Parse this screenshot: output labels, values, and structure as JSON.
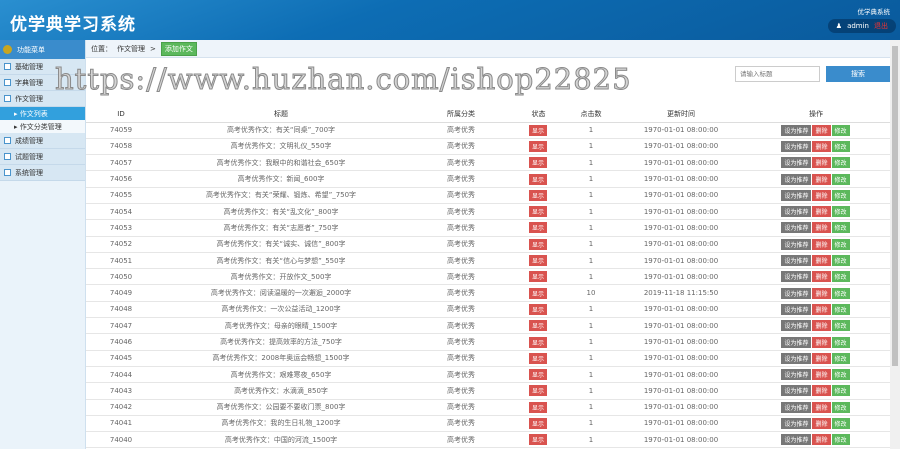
{
  "header": {
    "title": "优学典学习系统",
    "system_name": "优学典系统",
    "user": "admin",
    "logout": "退出"
  },
  "sidebar": {
    "heading": "功能菜单",
    "items": [
      {
        "label": "基础管理"
      },
      {
        "label": "字典管理"
      },
      {
        "label": "作文管理",
        "children": [
          {
            "label": "作文列表"
          },
          {
            "label": "作文分类管理"
          }
        ]
      },
      {
        "label": "成绩管理"
      },
      {
        "label": "试题管理"
      },
      {
        "label": "系统管理"
      }
    ]
  },
  "breadcrumb": {
    "prefix": "位置：",
    "parent": "作文管理",
    "sep": ">",
    "current": "添加作文"
  },
  "search": {
    "placeholder": "请输入标题",
    "button": "搜索"
  },
  "table": {
    "headers": [
      "ID",
      "标题",
      "所属分类",
      "状态",
      "点击数",
      "更新时间",
      "操作"
    ],
    "actions": {
      "recommend": "设为推荐",
      "delete": "删除",
      "edit": "修改"
    },
    "rows": [
      {
        "id": "74059",
        "title": "高考优秀作文：有关“同桌”_700字",
        "category": "高考优秀",
        "status": "显示",
        "clicks": "1",
        "time": "1970-01-01 08:00:00"
      },
      {
        "id": "74058",
        "title": "高考优秀作文：文明礼仪_550字",
        "category": "高考优秀",
        "status": "显示",
        "clicks": "1",
        "time": "1970-01-01 08:00:00"
      },
      {
        "id": "74057",
        "title": "高考优秀作文：我眼中的和谐社会_650字",
        "category": "高考优秀",
        "status": "显示",
        "clicks": "1",
        "time": "1970-01-01 08:00:00"
      },
      {
        "id": "74056",
        "title": "高考优秀作文：新闻_600字",
        "category": "高考优秀",
        "status": "显示",
        "clicks": "1",
        "time": "1970-01-01 08:00:00"
      },
      {
        "id": "74055",
        "title": "高考优秀作文：有关“荣耀、锻炼、希望”_750字",
        "category": "高考优秀",
        "status": "显示",
        "clicks": "1",
        "time": "1970-01-01 08:00:00"
      },
      {
        "id": "74054",
        "title": "高考优秀作文：有关“乱文化”_800字",
        "category": "高考优秀",
        "status": "显示",
        "clicks": "1",
        "time": "1970-01-01 08:00:00"
      },
      {
        "id": "74053",
        "title": "高考优秀作文：有关“志愿者”_750字",
        "category": "高考优秀",
        "status": "显示",
        "clicks": "1",
        "time": "1970-01-01 08:00:00"
      },
      {
        "id": "74052",
        "title": "高考优秀作文：有关“诚实、诚信”_800字",
        "category": "高考优秀",
        "status": "显示",
        "clicks": "1",
        "time": "1970-01-01 08:00:00"
      },
      {
        "id": "74051",
        "title": "高考优秀作文：有关“信心与梦想”_550字",
        "category": "高考优秀",
        "status": "显示",
        "clicks": "1",
        "time": "1970-01-01 08:00:00"
      },
      {
        "id": "74050",
        "title": "高考优秀作文：开放作文_500字",
        "category": "高考优秀",
        "status": "显示",
        "clicks": "1",
        "time": "1970-01-01 08:00:00"
      },
      {
        "id": "74049",
        "title": "高考优秀作文：阅读温暖的一次邂逅_2000字",
        "category": "高考优秀",
        "status": "显示",
        "clicks": "10",
        "time": "2019-11-18 11:15:50"
      },
      {
        "id": "74048",
        "title": "高考优秀作文：一次公益活动_1200字",
        "category": "高考优秀",
        "status": "显示",
        "clicks": "1",
        "time": "1970-01-01 08:00:00"
      },
      {
        "id": "74047",
        "title": "高考优秀作文：母亲的眼睛_1500字",
        "category": "高考优秀",
        "status": "显示",
        "clicks": "1",
        "time": "1970-01-01 08:00:00"
      },
      {
        "id": "74046",
        "title": "高考优秀作文：提高效率的方法_750字",
        "category": "高考优秀",
        "status": "显示",
        "clicks": "1",
        "time": "1970-01-01 08:00:00"
      },
      {
        "id": "74045",
        "title": "高考优秀作文：2008年奥运会畅想_1500字",
        "category": "高考优秀",
        "status": "显示",
        "clicks": "1",
        "time": "1970-01-01 08:00:00"
      },
      {
        "id": "74044",
        "title": "高考优秀作文：艰难寒夜_650字",
        "category": "高考优秀",
        "status": "显示",
        "clicks": "1",
        "time": "1970-01-01 08:00:00"
      },
      {
        "id": "74043",
        "title": "高考优秀作文：水滴滴_850字",
        "category": "高考优秀",
        "status": "显示",
        "clicks": "1",
        "time": "1970-01-01 08:00:00"
      },
      {
        "id": "74042",
        "title": "高考优秀作文：公园要不要收门票_800字",
        "category": "高考优秀",
        "status": "显示",
        "clicks": "1",
        "time": "1970-01-01 08:00:00"
      },
      {
        "id": "74041",
        "title": "高考优秀作文：我的生日礼物_1200字",
        "category": "高考优秀",
        "status": "显示",
        "clicks": "1",
        "time": "1970-01-01 08:00:00"
      },
      {
        "id": "74040",
        "title": "高考优秀作文：中国的河流_1500字",
        "category": "高考优秀",
        "status": "显示",
        "clicks": "1",
        "time": "1970-01-01 08:00:00"
      }
    ]
  },
  "watermark": "https://www.huzhan.com/ishop22825"
}
